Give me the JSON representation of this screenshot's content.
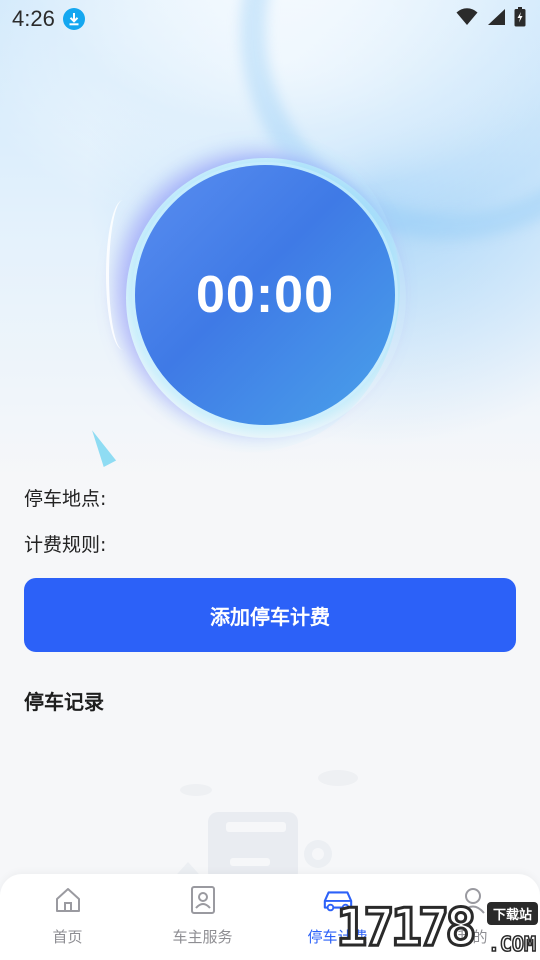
{
  "status_bar": {
    "time": "4:26",
    "icons": [
      "download-icon",
      "wifi-icon",
      "signal-icon",
      "battery-charging-icon"
    ]
  },
  "timer": {
    "value": "00:00"
  },
  "info": {
    "location_label": "停车地点:",
    "rule_label": "计费规则:"
  },
  "primary_action": {
    "label": "添加停车计费"
  },
  "records": {
    "title": "停车记录"
  },
  "bottom_nav": {
    "items": [
      {
        "label": "首页",
        "icon": "home-icon"
      },
      {
        "label": "车主服务",
        "icon": "id-card-icon"
      },
      {
        "label": "停车计费",
        "icon": "car-icon"
      },
      {
        "label": "我的",
        "icon": "profile-icon"
      }
    ],
    "active": "停车计费"
  },
  "watermark": {
    "number": "17178",
    "badge": "下载站",
    "suffix": ".COM"
  },
  "colors": {
    "accent": "#2c61f8",
    "timer_bg": "#4a86ec",
    "nav_inactive": "#8e8e93"
  }
}
